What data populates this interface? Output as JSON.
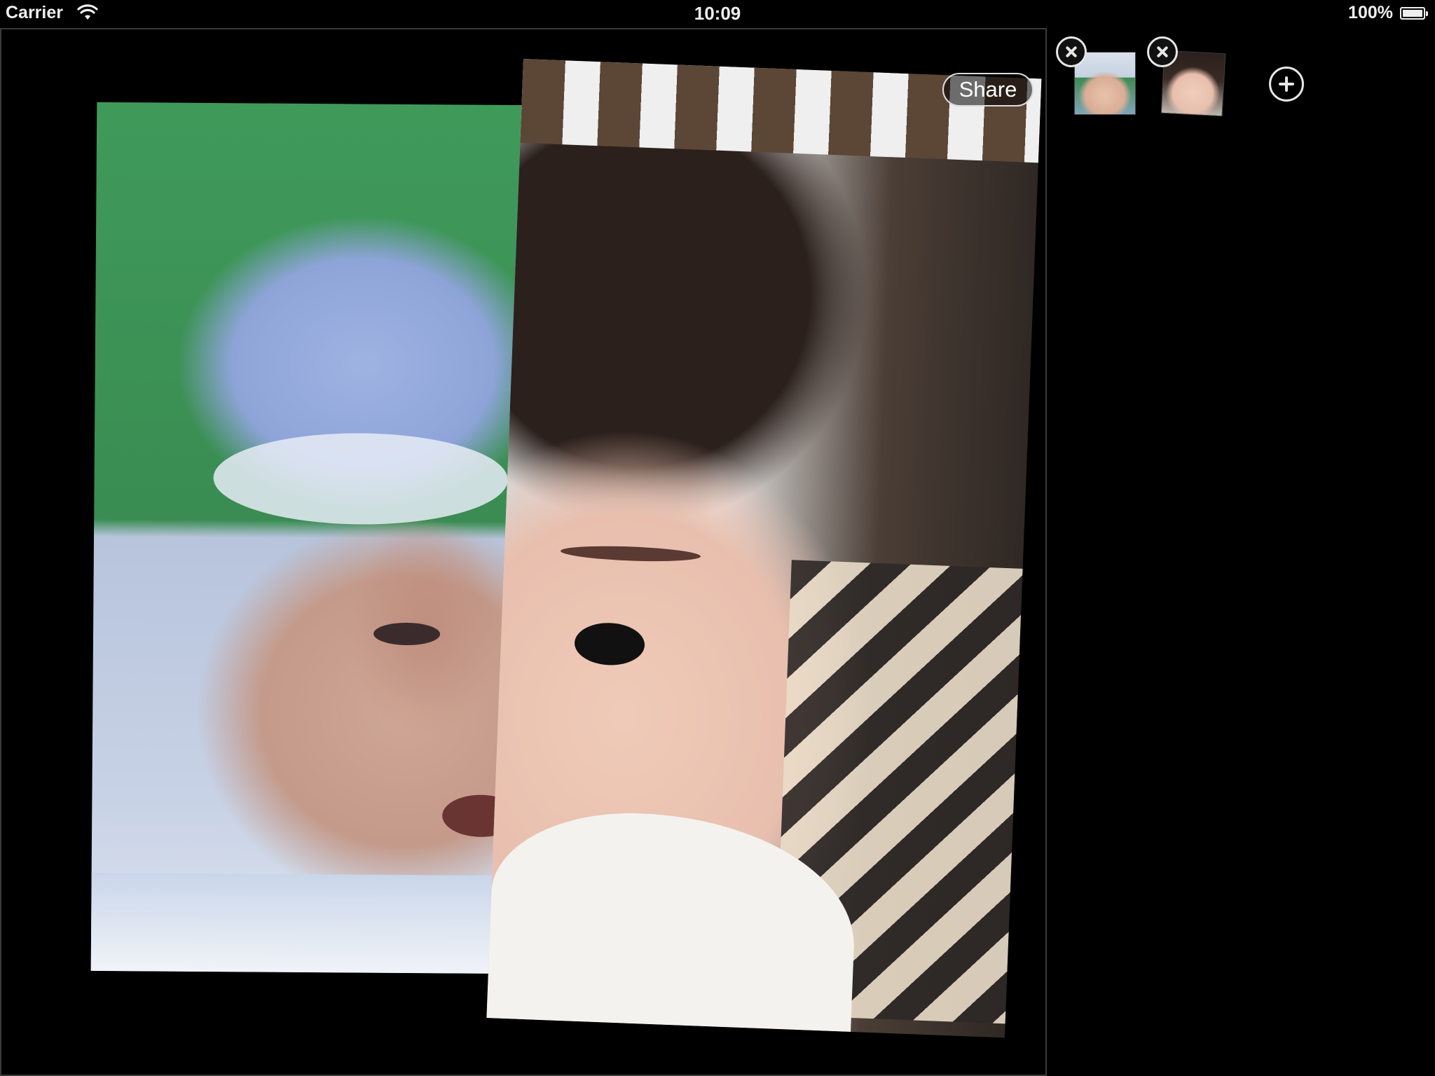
{
  "status_bar": {
    "carrier": "Carrier",
    "time": "10:09",
    "battery": "100%",
    "icons": [
      "wifi-icon",
      "battery-icon"
    ]
  },
  "canvas": {
    "share_label": "Share",
    "photos": [
      {
        "name": "left-half-photo",
        "description_icon": "photo"
      },
      {
        "name": "right-half-photo",
        "description_icon": "photo"
      }
    ]
  },
  "tray": {
    "thumbnails": [
      {
        "name": "thumbnail-1",
        "remove_icon": "close-circle-icon"
      },
      {
        "name": "thumbnail-2",
        "remove_icon": "close-circle-icon"
      }
    ],
    "add_icon": "plus-circle-icon"
  }
}
